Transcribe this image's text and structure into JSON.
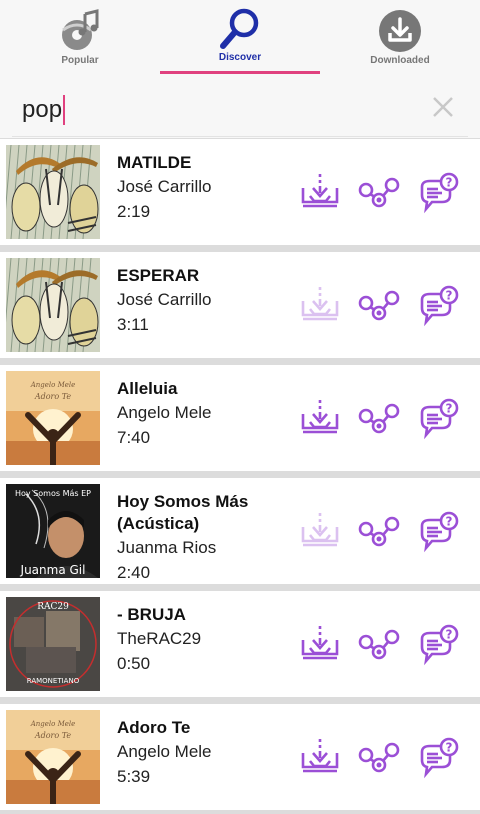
{
  "tabs": {
    "popular": {
      "label": "Popular",
      "icon": "music-disc-icon"
    },
    "discover": {
      "label": "Discover",
      "icon": "search-icon"
    },
    "downloaded": {
      "label": "Downloaded",
      "icon": "download-icon"
    }
  },
  "search": {
    "value": "pop"
  },
  "songs": [
    {
      "title": "MATILDE",
      "artist": "José Carrillo",
      "duration": "2:19",
      "art": "rain-cartoon",
      "download_enabled": true
    },
    {
      "title": "ESPERAR",
      "artist": "José Carrillo",
      "duration": "3:11",
      "art": "rain-cartoon",
      "download_enabled": false
    },
    {
      "title": "Alleluia",
      "artist": "Angelo Mele",
      "duration": "7:40",
      "art": "sunset-arms",
      "cover_text": [
        "Angelo Mele",
        "Adoro Te"
      ],
      "download_enabled": true
    },
    {
      "title": "Hoy Somos Más (Acústica)",
      "artist": "Juanma Rios",
      "duration": "2:40",
      "art": "portrait-dark",
      "cover_text": [
        "Hoy Somos Más EP",
        "Juanma Gil"
      ],
      "download_enabled": false
    },
    {
      "title": "- BRUJA",
      "artist": "TheRAC29",
      "duration": "0:50",
      "art": "collage-circle",
      "cover_text": [
        "RAC29",
        "RAMONETIANO"
      ],
      "download_enabled": true
    },
    {
      "title": "Adoro Te",
      "artist": "Angelo Mele",
      "duration": "5:39",
      "art": "sunset-arms",
      "cover_text": [
        "Angelo Mele",
        "Adoro Te"
      ],
      "download_enabled": true
    }
  ],
  "colors": {
    "accent": "#e0417f",
    "active_tab": "#1f2fa8",
    "action_icon": "#9b4fd6"
  }
}
